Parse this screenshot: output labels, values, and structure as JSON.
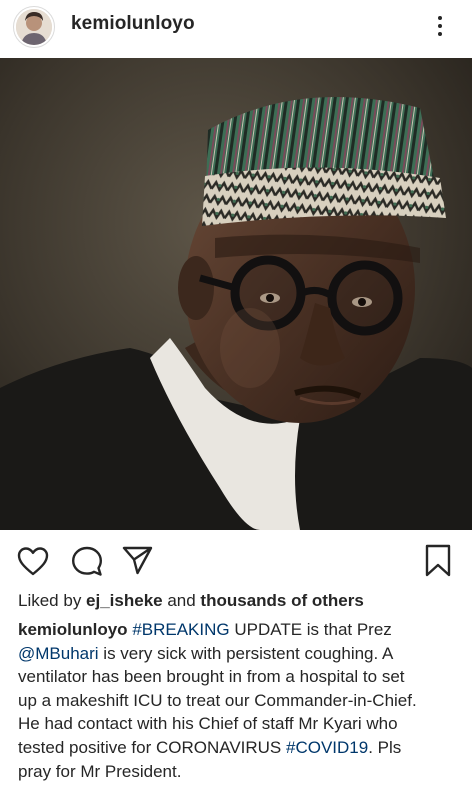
{
  "post": {
    "username": "kemiolunloyo",
    "photo_subject": "portrait-photo"
  },
  "likes": {
    "prefix": "Liked by ",
    "user": "ej_isheke",
    "middle": " and ",
    "others": "thousands of others"
  },
  "caption": {
    "username": "kemiolunloyo",
    "line1_tag": "#BREAKING",
    "line1_rest": " UPDATE is that Prez",
    "line2_mention": "@MBuhari",
    "line2_rest": " is very sick with persistent coughing. A",
    "line3": "ventilator has been brought in from a  hospital to set",
    "line4": "up a makeshift ICU to treat our Commander-in-Chief.",
    "line5": "He had contact with his Chief of staff Mr Kyari who",
    "line6_pre": "tested positive for CORONAVIRUS ",
    "line6_tag": "#COVID19",
    "line6_post": ". Pls",
    "line7": "pray for Mr President."
  },
  "colors": {
    "text": "#262626",
    "link": "#00376b",
    "divider": "#dbdbdb"
  },
  "icons": [
    "more-options-icon",
    "heart-icon",
    "comment-icon",
    "share-icon",
    "bookmark-icon"
  ]
}
